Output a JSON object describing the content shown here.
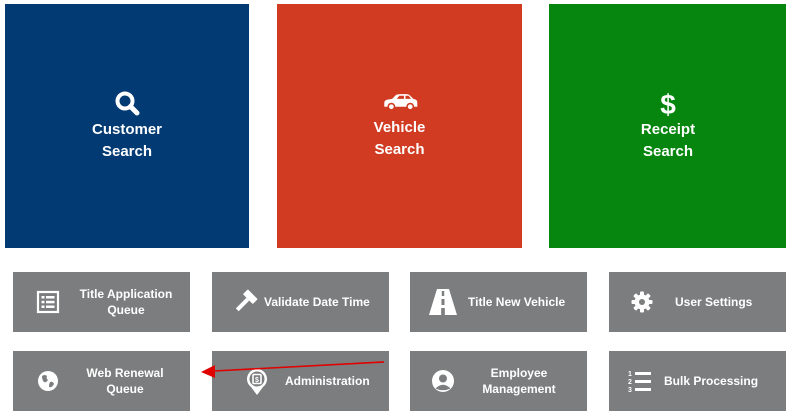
{
  "tiles": {
    "customer_search": {
      "line1": "Customer",
      "line2": "Search",
      "color": "#023a73",
      "icon": "search-icon"
    },
    "vehicle_search": {
      "line1": "Vehicle",
      "line2": "Search",
      "color": "#d03b22",
      "icon": "car-icon"
    },
    "receipt_search": {
      "line1": "Receipt",
      "line2": "Search",
      "color": "#07860f",
      "icon": "dollar-icon"
    }
  },
  "buttons": {
    "title_application_queue": {
      "line1": "Title Application",
      "line2": "Queue",
      "icon": "list-icon"
    },
    "validate_date_time": {
      "label": "Validate Date Time",
      "icon": "gavel-icon"
    },
    "title_new_vehicle": {
      "label": "Title New Vehicle",
      "icon": "road-icon"
    },
    "user_settings": {
      "label": "User Settings",
      "icon": "gear-icon"
    },
    "web_renewal_queue": {
      "line1": "Web Renewal",
      "line2": "Queue",
      "icon": "globe-icon"
    },
    "administration": {
      "label": "Administration",
      "icon": "badge-icon"
    },
    "employee_management": {
      "line1": "Employee",
      "line2": "Management",
      "icon": "user-icon"
    },
    "bulk_processing": {
      "label": "Bulk Processing",
      "icon": "ordered-list-icon"
    }
  },
  "colors": {
    "button_gray": "#7b7d7e",
    "annotation_arrow": "#e00000"
  }
}
